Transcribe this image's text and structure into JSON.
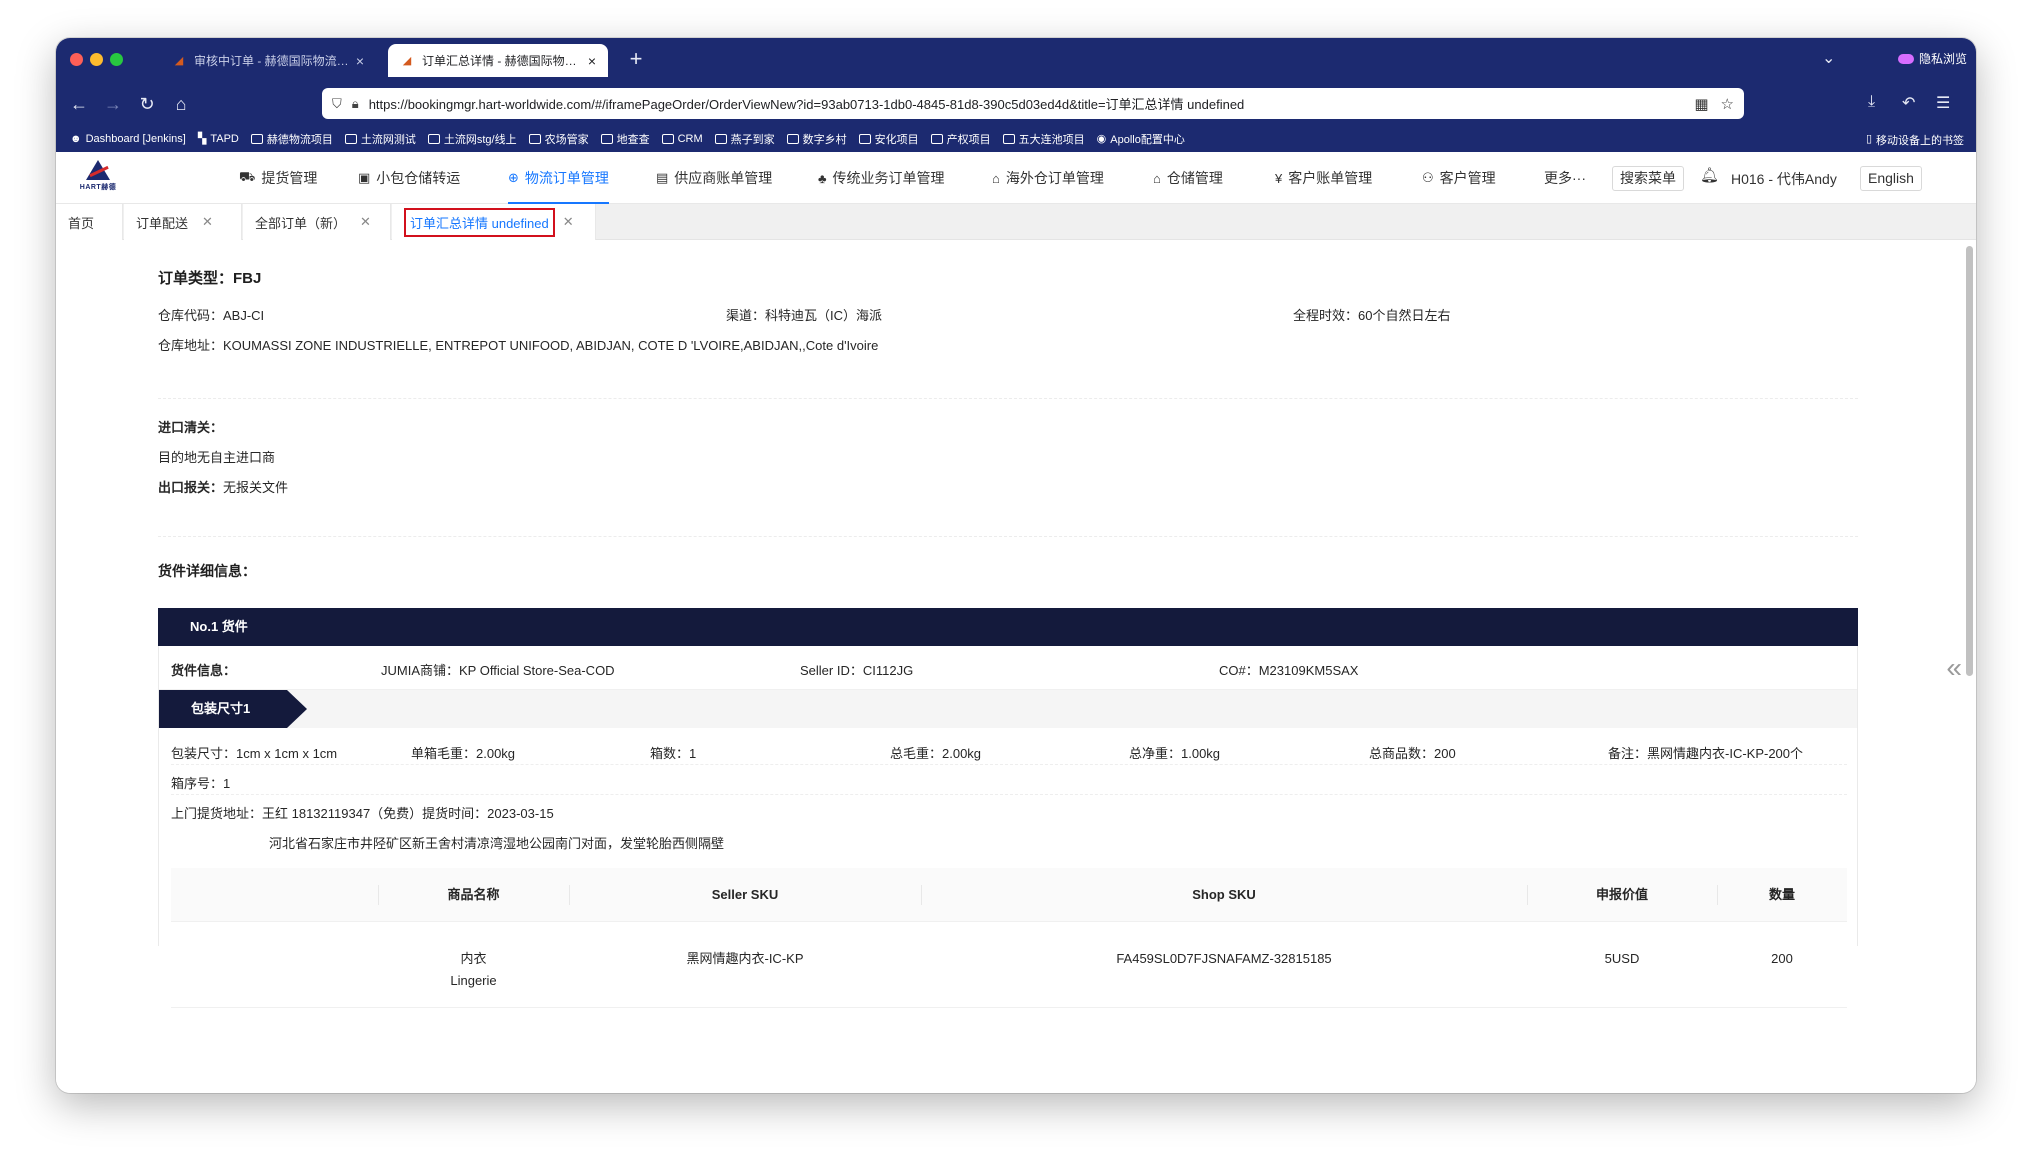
{
  "browser": {
    "tabs": [
      {
        "title": "审核中订单 - 赫德国际物流管理系统"
      },
      {
        "title": "订单汇总详情 - 赫德国际物流管理系统"
      }
    ],
    "new_tab": "+",
    "private_label": "隐私浏览",
    "url": "https://bookingmgr.hart-worldwide.com/#/iframePageOrder/OrderViewNew?id=93ab0713-1db0-4845-81d8-390c5d03ed4d&title=订单汇总详情 undefined",
    "bookmarks": [
      "Dashboard [Jenkins]",
      "TAPD",
      "赫德物流项目",
      "土流网测试",
      "土流网stg/线上",
      "农场管家",
      "地查查",
      "CRM",
      "燕子到家",
      "数字乡村",
      "安化项目",
      "产权项目",
      "五大连池项目",
      "Apollo配置中心"
    ],
    "bookmarks_right": "移动设备上的书签"
  },
  "app": {
    "logo_text": "HART赫德",
    "menu": [
      {
        "label": "提货管理",
        "icon": "truck-icon"
      },
      {
        "label": "小包仓储转运",
        "icon": "package-icon"
      },
      {
        "label": "物流订单管理",
        "icon": "globe-icon"
      },
      {
        "label": "供应商账单管理",
        "icon": "bill-icon"
      },
      {
        "label": "传统业务订单管理",
        "icon": "tree-icon"
      },
      {
        "label": "海外仓订单管理",
        "icon": "house-icon"
      },
      {
        "label": "仓储管理",
        "icon": "warehouse-icon"
      },
      {
        "label": "客户账单管理",
        "icon": "yen-icon"
      },
      {
        "label": "客户管理",
        "icon": "users-icon"
      },
      {
        "label": "更多···",
        "icon": ""
      }
    ],
    "search_menu": "搜索菜单",
    "user": "H016 - 代伟Andy",
    "language": "English"
  },
  "page_tabs": [
    {
      "label": "首页",
      "closable": false
    },
    {
      "label": "订单配送",
      "closable": true
    },
    {
      "label": "全部订单（新）",
      "closable": true
    },
    {
      "label": "订单汇总详情 undefined",
      "closable": true
    }
  ],
  "order": {
    "type_label": "订单类型：",
    "type_value": "FBJ",
    "warehouse_code": "仓库代码：ABJ-CI",
    "channel": "渠道：科特迪瓦（IC）海派",
    "timeliness": "全程时效：60个自然日左右",
    "warehouse_address": "仓库地址：KOUMASSI ZONE INDUSTRIELLE, ENTREPOT UNIFOOD, ABIDJAN, COTE D 'LVOIRE,ABIDJAN,,Cote d'Ivoire",
    "import_label": "进口清关：",
    "import_value": "目的地无自主进口商",
    "export_label": "出口报关：",
    "export_value": "无报关文件",
    "cargo_section_title": "货件详细信息："
  },
  "cargo": {
    "header": "No.1 货件",
    "info_label": "货件信息：",
    "shop": "JUMIA商铺：KP Official Store-Sea-COD",
    "seller_id": "Seller ID：CI112JG",
    "co": "CO#：M23109KM5SAX",
    "pack_tag": "包装尺寸1",
    "pack_size": "包装尺寸：1cm x 1cm x 1cm",
    "box_weight": "单箱毛重：2.00kg",
    "box_count": "箱数：1",
    "gross_weight": "总毛重：2.00kg",
    "net_weight": "总净重：1.00kg",
    "total_items": "总商品数：200",
    "remark": "备注：黑网情趣内衣-IC-KP-200个",
    "box_no": "箱序号：1",
    "pickup": "上门提货地址：王红     18132119347（免费）提货时间：2023-03-15",
    "pickup_address": "河北省石家庄市井陉矿区新王舍村清凉湾湿地公园南门对面，发堂轮胎西侧隔壁",
    "table": {
      "headers": [
        "商品名称",
        "Seller SKU",
        "Shop SKU",
        "申报价值",
        "数量"
      ],
      "rows": [
        {
          "name_cn": "内衣",
          "name_en": "Lingerie",
          "seller_sku": "黑网情趣内衣-IC-KP",
          "shop_sku": "FA459SL0D7FJSNAFAMZ-32815185",
          "value": "5USD",
          "qty": "200"
        }
      ]
    }
  }
}
